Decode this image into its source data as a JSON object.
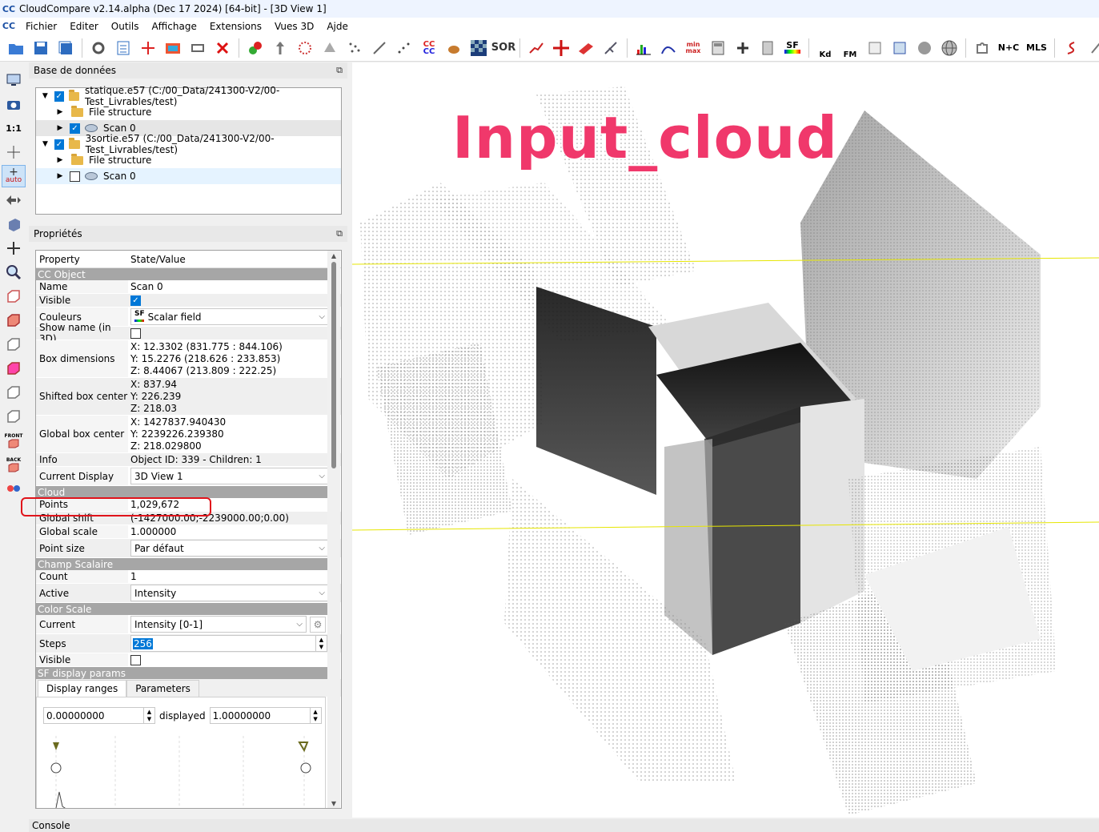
{
  "window": {
    "title": "CloudCompare v2.14.alpha (Dec 17 2024) [64-bit] - [3D View 1]",
    "app_icon": "CC"
  },
  "menu": [
    "Fichier",
    "Editer",
    "Outils",
    "Affichage",
    "Extensions",
    "Vues 3D",
    "Ajde"
  ],
  "toolbar": {
    "labels": {
      "cc": "CC",
      "sor": "SOR",
      "sf": "SF",
      "kd": "Kd",
      "fm": "FM",
      "nc": "N+C",
      "mls": "MLS"
    }
  },
  "left_toolbar": {
    "scale_label": "1:1",
    "auto_label": "auto",
    "front_label": "FRONT",
    "back_label": "BACK"
  },
  "db_panel": {
    "title": "Base de données",
    "items": [
      {
        "label": "statique.e57 (C:/00_Data/241300-V2/00-Test_Livrables/test)"
      },
      {
        "label": "File structure"
      },
      {
        "label": "Scan 0"
      },
      {
        "label": "3sortie.e57 (C:/00_Data/241300-V2/00-Test_Livrables/test)"
      },
      {
        "label": "File structure"
      },
      {
        "label": "Scan 0"
      }
    ]
  },
  "props_panel": {
    "title": "Propriétés",
    "header": {
      "property": "Property",
      "value": "State/Value"
    },
    "sections": {
      "cc_object": "CC Object",
      "cloud": "Cloud",
      "scalar_field": "Champ Scalaire",
      "color_scale": "Color Scale",
      "sf_display": "SF display params"
    },
    "rows": {
      "name": {
        "k": "Name",
        "v": "Scan 0"
      },
      "visible": {
        "k": "Visible"
      },
      "couleurs": {
        "k": "Couleurs",
        "v": "Scalar field"
      },
      "show_name": {
        "k": "Show name (in 3D)"
      },
      "box_dims": {
        "k": "Box dimensions",
        "x": "X: 12.3302 (831.775 : 844.106)",
        "y": "Y: 15.2276 (218.626 : 233.853)",
        "z": "Z: 8.44067 (213.809 : 222.25)"
      },
      "shifted_center": {
        "k": "Shifted box center",
        "x": "X: 837.94",
        "y": "Y: 226.239",
        "z": "Z: 218.03"
      },
      "global_center": {
        "k": "Global box center",
        "x": "X: 1427837.940430",
        "y": "Y: 2239226.239380",
        "z": "Z: 218.029800"
      },
      "info": {
        "k": "Info",
        "v": "Object ID: 339 - Children: 1"
      },
      "current_display": {
        "k": "Current Display",
        "v": "3D View 1"
      },
      "points": {
        "k": "Points",
        "v": "1,029,672"
      },
      "global_shift": {
        "k": "Global shift",
        "v": "(-1427000.00;-2239000.00;0.00)"
      },
      "global_scale": {
        "k": "Global scale",
        "v": "1.000000"
      },
      "point_size": {
        "k": "Point size",
        "v": "Par défaut"
      },
      "count": {
        "k": "Count",
        "v": "1"
      },
      "active": {
        "k": "Active",
        "v": "Intensity"
      },
      "current": {
        "k": "Current",
        "v": "Intensity [0-1]"
      },
      "steps": {
        "k": "Steps",
        "v": "256"
      },
      "cs_visible": {
        "k": "Visible"
      }
    },
    "tabs": [
      "Display ranges",
      "Parameters"
    ],
    "range": {
      "min": "0.00000000",
      "displayed_label": "displayed",
      "max": "1.00000000"
    }
  },
  "view": {
    "overlay_title": "Input_cloud",
    "guide_line_color": "#e6e600"
  },
  "console": {
    "label": "Console"
  }
}
